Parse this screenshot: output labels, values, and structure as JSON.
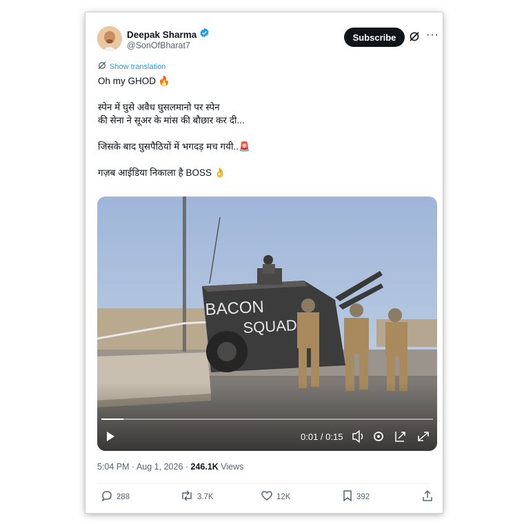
{
  "author": {
    "name": "Deepak Sharma",
    "handle": "@SonOfBharat7",
    "verified": true
  },
  "header": {
    "subscribe_label": "Subscribe",
    "more_label": "···"
  },
  "translation_label": "Show translation",
  "tweet": {
    "line1": "Oh my GHOD 🔥",
    "line2": "स्पेन में घुसे अवैध घुसलमानो पर स्पेन",
    "line3": "की सेना ने सूअर के मांस की बौछार कर दी...",
    "line4": "जिसके बाद घुसपैठियों में भगदड़ मच गयी..🚨",
    "line5": "गज़ब आईडिया निकाला है BOSS 👌"
  },
  "video": {
    "vehicle_text_1": "BACON",
    "vehicle_text_2": "SQUAD",
    "time_display": "0:01 / 0:15",
    "progress": 0.067
  },
  "meta": {
    "timestamp": "5:04 PM · Aug 1, 2026 · ",
    "views_count": "246.1K",
    "views_label": " Views"
  },
  "actions": {
    "replies": "288",
    "reposts": "3.7K",
    "likes": "12K",
    "bookmarks": "392"
  },
  "colors": {
    "accent": "#1d9bf0",
    "text": "#0f1419",
    "muted": "#536471"
  },
  "icons": [
    "verified-badge-icon",
    "grok-icon",
    "translate-icon",
    "play-icon",
    "volume-icon",
    "settings-icon",
    "pip-icon",
    "fullscreen-icon",
    "reply-icon",
    "repost-icon",
    "like-icon",
    "bookmark-icon",
    "share-icon"
  ]
}
